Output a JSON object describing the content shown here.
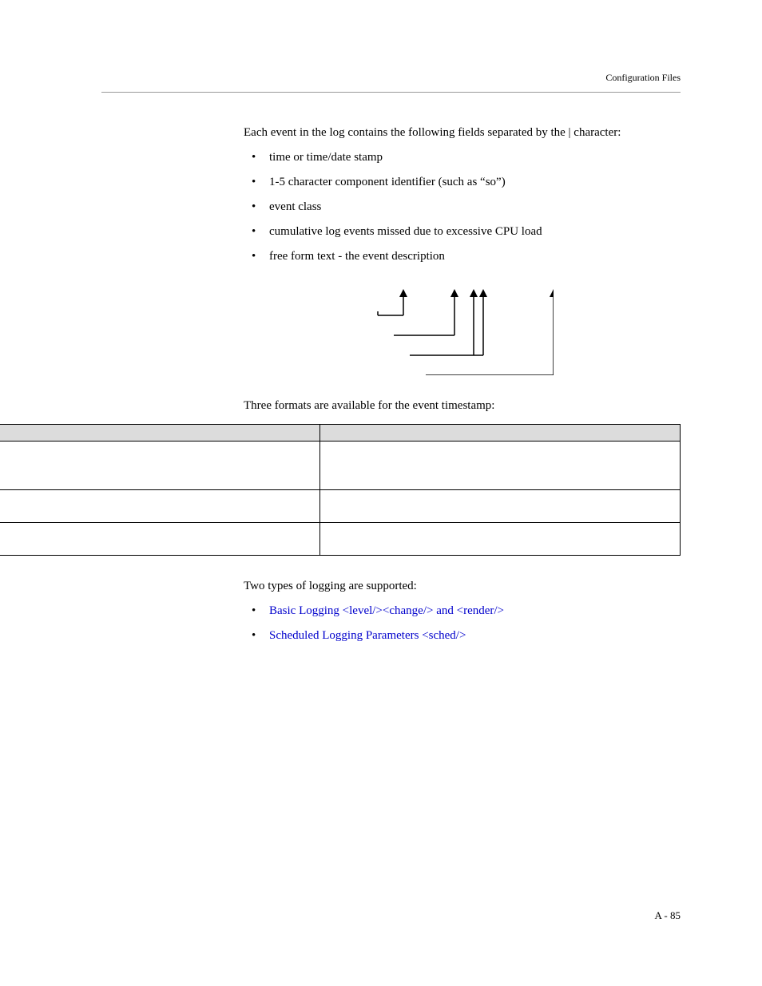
{
  "header": {
    "label": "Configuration Files"
  },
  "intro": "Each event in the log contains the following fields separated by the | character:",
  "field_bullets": [
    "time or time/date stamp",
    "1-5 character component identifier (such as “so”)",
    "event class",
    "cumulative log events missed due to excessive CPU load",
    "free form text - the event description"
  ],
  "formats_intro": "Three formats are available for the event timestamp:",
  "table": {
    "headers": [
      "",
      ""
    ],
    "rows": [
      [
        "",
        ""
      ],
      [
        "",
        ""
      ],
      [
        "",
        ""
      ]
    ]
  },
  "logging_intro": "Two types of logging are supported:",
  "logging_links": [
    "Basic Logging <level/><change/> and <render/>",
    "Scheduled Logging Parameters <sched/>"
  ],
  "footer": "A - 85"
}
